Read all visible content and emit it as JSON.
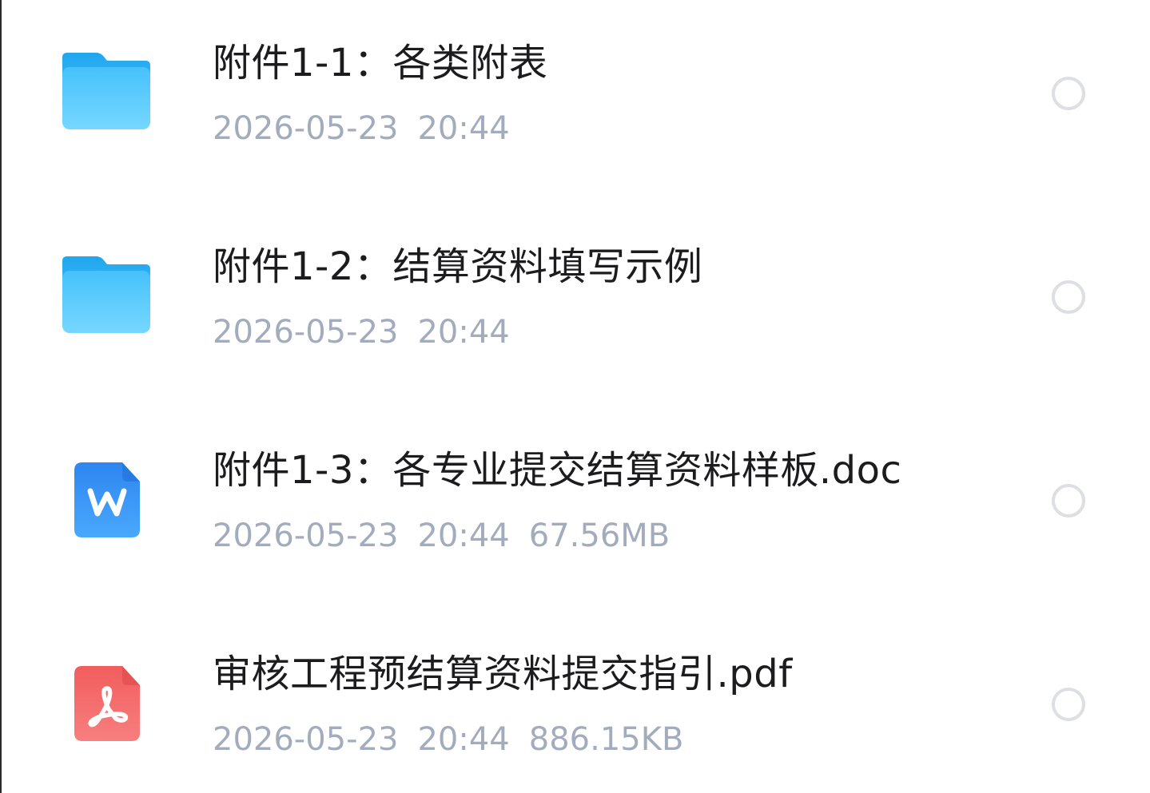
{
  "files": [
    {
      "name": "附件1-1：各类附表",
      "date": "2026-05-23",
      "time": "20:44",
      "size": "",
      "icon": "folder-icon"
    },
    {
      "name": "附件1-2：结算资料填写示例",
      "date": "2026-05-23",
      "time": "20:44",
      "size": "",
      "icon": "folder-icon"
    },
    {
      "name": "附件1-3：各专业提交结算资料样板.doc",
      "date": "2026-05-23",
      "time": "20:44",
      "size": "67.56MB",
      "icon": "word-doc-icon"
    },
    {
      "name": "审核工程预结算资料提交指引.pdf",
      "date": "2026-05-23",
      "time": "20:44",
      "size": "886.15KB",
      "icon": "pdf-doc-icon"
    }
  ],
  "colors": {
    "folder_top": "#2bb0f2",
    "folder_bottom": "#6fd3ff",
    "word": "#2f8ef4",
    "pdf": "#f36c6c",
    "name_text": "#1c1c1e",
    "meta_text": "#a3acbd",
    "radio_border": "#dddfe3"
  }
}
